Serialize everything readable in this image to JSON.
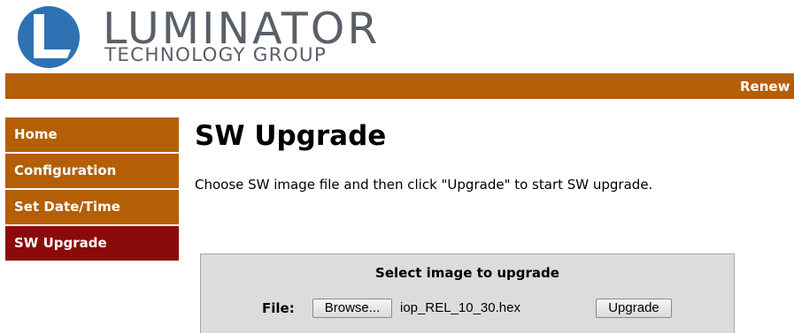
{
  "logo": {
    "line1": "LUMINATOR",
    "line2": "TECHNOLOGY GROUP",
    "colors": {
      "circle": "#2e72b4",
      "text": "#5a6068"
    }
  },
  "banner": {
    "text": "Renew",
    "color": "#b45f06"
  },
  "sidebar": {
    "items": [
      {
        "label": "Home"
      },
      {
        "label": "Configuration"
      },
      {
        "label": "Set Date/Time"
      },
      {
        "label": "SW Upgrade",
        "active": true
      }
    ],
    "colors": {
      "default": "#b45f06",
      "active": "#8b0a0a"
    }
  },
  "main": {
    "title": "SW Upgrade",
    "instructions": "Choose SW image file and then click \"Upgrade\" to start SW upgrade.",
    "upload": {
      "title": "Select image to upgrade",
      "file_label": "File:",
      "browse_label": "Browse...",
      "file_name": "iop_REL_10_30.hex",
      "upgrade_label": "Upgrade"
    }
  }
}
